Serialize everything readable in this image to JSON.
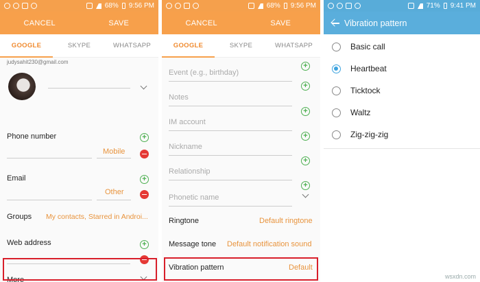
{
  "status_left": {
    "time": "9:56 PM",
    "battery": "68%"
  },
  "status_right": {
    "time": "9:41 PM",
    "battery": "71%"
  },
  "edit_contact": {
    "cancel_label": "CANCEL",
    "save_label": "SAVE",
    "tabs": [
      "GOOGLE",
      "SKYPE",
      "WHATSAPP"
    ],
    "account_email": "judysahit230@gmail.com",
    "phone_label": "Phone number",
    "phone_type": "Mobile",
    "email_label": "Email",
    "email_type": "Other",
    "groups_label": "Groups",
    "groups_value": "My contacts, Starred in Androi...",
    "web_label": "Web address",
    "more_label": "More"
  },
  "more_fields": {
    "event_placeholder": "Event (e.g., birthday)",
    "notes_placeholder": "Notes",
    "im_placeholder": "IM account",
    "nickname_placeholder": "Nickname",
    "relationship_placeholder": "Relationship",
    "phonetic_placeholder": "Phonetic name",
    "ringtone_label": "Ringtone",
    "ringtone_value": "Default ringtone",
    "message_tone_label": "Message tone",
    "message_tone_value": "Default notification sound",
    "vibration_label": "Vibration pattern",
    "vibration_value": "Default"
  },
  "vibration_screen": {
    "title": "Vibration pattern",
    "options": [
      "Basic call",
      "Heartbeat",
      "Ticktock",
      "Waltz",
      "Zig-zig-zig"
    ],
    "selected": "Heartbeat"
  },
  "watermark": "wsxdn.com",
  "colors": {
    "orange_header": "#f7a04b",
    "blue_header": "#5aaedc",
    "highlight_box": "#d81e2a",
    "accent_text": "#e8933c"
  }
}
